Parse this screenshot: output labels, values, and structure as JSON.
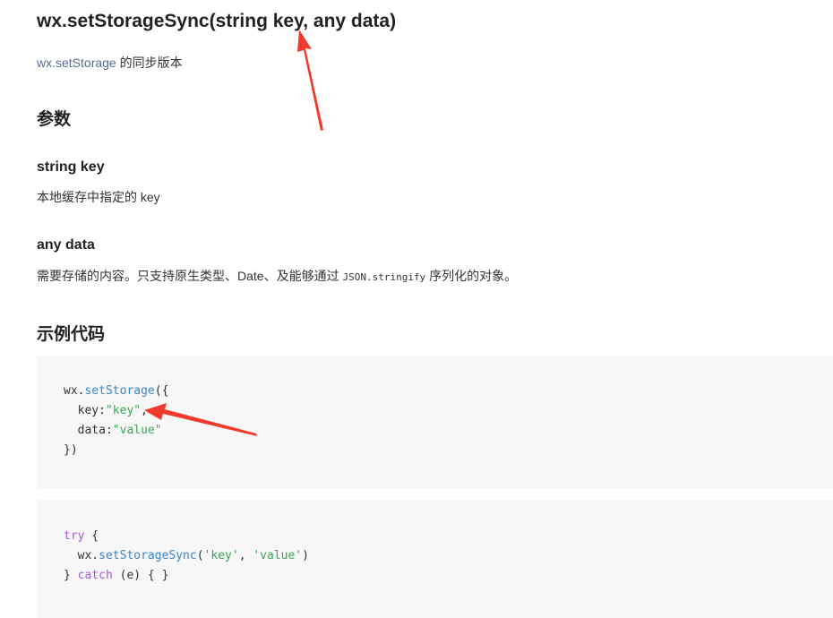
{
  "api": {
    "title": "wx.setStorageSync(string key, any data)",
    "desc_link": "wx.setStorage",
    "desc_rest": " 的同步版本"
  },
  "params": {
    "heading": "参数",
    "items": [
      {
        "name": "string key",
        "desc": "本地缓存中指定的 key"
      },
      {
        "name": "any data",
        "desc_before": "需要存储的内容。只支持原生类型、Date、及能够通过 ",
        "desc_code": "JSON.stringify",
        "desc_after": " 序列化的对象。"
      }
    ]
  },
  "example": {
    "heading": "示例代码",
    "block1": {
      "l1_obj": "wx.",
      "l1_fn": "setStorage",
      "l1_end": "({",
      "l2_key": "  key:",
      "l2_str": "\"key\"",
      "l2_end": ",",
      "l3_key": "  data:",
      "l3_str": "\"value\"",
      "l4": "})"
    },
    "block2": {
      "l1_kw": "try",
      "l1_end": " {",
      "l2_obj": "  wx.",
      "l2_fn": "setStorageSync",
      "l2_open": "(",
      "l2_s1": "'key'",
      "l2_sep": ", ",
      "l2_s2": "'value'",
      "l2_close": ")",
      "l3_open": "} ",
      "l3_kw": "catch",
      "l3_end": " (e) { }"
    }
  },
  "colors": {
    "link": "#576b95",
    "function": "#3a86c8",
    "string": "#3aa655",
    "keyword": "#a35cd6",
    "code_bg": "#f7f7f7",
    "annotation_arrow": "#f03b2c"
  }
}
